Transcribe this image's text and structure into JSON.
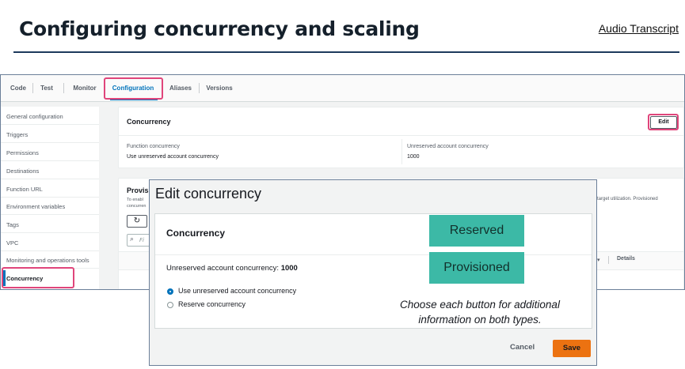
{
  "header": {
    "title": "Configuring concurrency and scaling",
    "audio_link": "Audio Transcript"
  },
  "console": {
    "tabs": [
      {
        "label": "Code"
      },
      {
        "label": "Test"
      },
      {
        "label": "Monitor"
      },
      {
        "label": "Configuration",
        "active": true
      },
      {
        "label": "Aliases"
      },
      {
        "label": "Versions"
      }
    ],
    "sidebar": [
      {
        "label": "General configuration"
      },
      {
        "label": "Triggers"
      },
      {
        "label": "Permissions"
      },
      {
        "label": "Destinations"
      },
      {
        "label": "Function URL"
      },
      {
        "label": "Environment variables"
      },
      {
        "label": "Tags"
      },
      {
        "label": "VPC"
      },
      {
        "label": "Monitoring and operations tools"
      },
      {
        "label": "Concurrency",
        "active": true
      }
    ],
    "concurrency_panel": {
      "title": "Concurrency",
      "edit_label": "Edit",
      "function_concurrency_label": "Function concurrency",
      "function_concurrency_value": "Use unreserved account concurrency",
      "unreserved_label": "Unreserved account concurrency",
      "unreserved_value": "1000"
    },
    "provisioned_panel": {
      "title_fragment": "Provisi",
      "desc_fragment_left": "To enabl",
      "desc_fragment_left2": "concurren",
      "desc_fragment_right": "target utilization. Provisioned",
      "search_fragment": "Fi",
      "details_col": "Details"
    }
  },
  "modal": {
    "title": "Edit concurrency",
    "card_title": "Concurrency",
    "unreserved_text": "Unreserved account concurrency: ",
    "unreserved_value": "1000",
    "options": [
      {
        "label": "Use unreserved account concurrency",
        "selected": true
      },
      {
        "label": "Reserve concurrency",
        "selected": false
      }
    ],
    "cancel_label": "Cancel",
    "save_label": "Save"
  },
  "overlay": {
    "reserved_label": "Reserved",
    "provisioned_label": "Provisioned",
    "hint": "Choose each button for additional information on both types.",
    "accent_color": "#3cb9a6",
    "highlight_color": "#e0457b"
  }
}
